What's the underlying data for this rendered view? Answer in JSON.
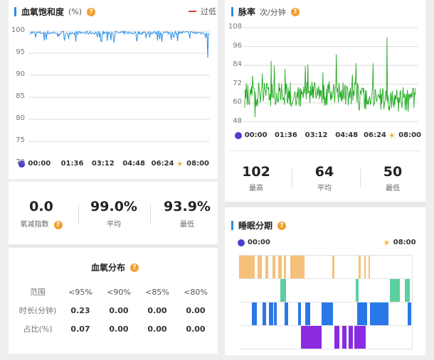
{
  "colors": {
    "accent": "#2a8fe8",
    "help": "#f0a032",
    "spo2_line": "#2a8fe8",
    "hr_line": "#22aa22",
    "alarm": "#e04040",
    "moon": "#4a3fd0",
    "sun": "#f0a020",
    "stage_awake": "#f5c07a",
    "stage_rem": "#5ccfa0",
    "stage_light": "#2a78e8",
    "stage_deep": "#8a2be2"
  },
  "spo2": {
    "title": "血氧饱和度",
    "unit": "(%)",
    "help_icon": "?",
    "legend": "过低",
    "y_ticks": [
      "100",
      "95",
      "90",
      "85",
      "80",
      "75",
      "70"
    ],
    "times": [
      "00:00",
      "01:36",
      "03:12",
      "04:48",
      "06:24",
      "08:00"
    ],
    "stats": [
      {
        "value": "0.0",
        "label": "氧减指数"
      },
      {
        "value": "99.0%",
        "label": "平均"
      },
      {
        "value": "93.9%",
        "label": "最低"
      }
    ]
  },
  "hr": {
    "title": "脉率",
    "unit": "次/分钟",
    "help_icon": "?",
    "y_ticks": [
      "108",
      "96",
      "84",
      "72",
      "60",
      "48"
    ],
    "times": [
      "00:00",
      "01:36",
      "03:12",
      "04:48",
      "06:24",
      "08:00"
    ],
    "stats": [
      {
        "value": "102",
        "label": "最高"
      },
      {
        "value": "64",
        "label": "平均"
      },
      {
        "value": "50",
        "label": "最低"
      }
    ]
  },
  "dist": {
    "title": "血氧分布",
    "help_icon": "?",
    "headers": [
      "范围",
      "<95%",
      "<90%",
      "<85%",
      "<80%"
    ],
    "rows": [
      [
        "时长(分钟)",
        "0.23",
        "0.00",
        "0.00",
        "0.00"
      ],
      [
        "占比(%)",
        "0.07",
        "0.00",
        "0.00",
        "0.00"
      ]
    ]
  },
  "sleep": {
    "title": "睡眠分期",
    "help_icon": "?",
    "start": "00:00",
    "end": "08:00"
  },
  "chart_data": [
    {
      "type": "line",
      "title": "血氧饱和度",
      "ylabel": "(%)",
      "ylim": [
        70,
        100
      ],
      "x": [
        "00:00",
        "01:36",
        "03:12",
        "04:48",
        "06:24",
        "08:00"
      ],
      "series": [
        {
          "name": "",
          "summary": {
            "mean": 99.0,
            "min": 93.9
          }
        }
      ]
    },
    {
      "type": "line",
      "title": "脉率",
      "ylabel": "次/分钟",
      "ylim": [
        48,
        108
      ],
      "x": [
        "00:00",
        "01:36",
        "03:12",
        "04:48",
        "06:24",
        "08:00"
      ],
      "series": [
        {
          "name": "",
          "summary": {
            "max": 102,
            "mean": 64,
            "min": 50
          }
        }
      ]
    }
  ]
}
